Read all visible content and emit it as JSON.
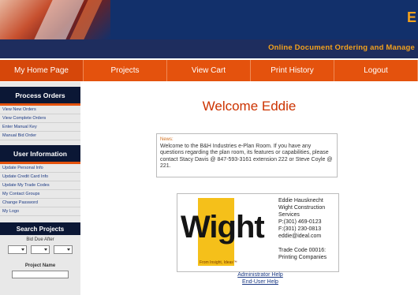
{
  "banner": {
    "letter": "E"
  },
  "subbar": {
    "text": "Online Document Ordering and Manage"
  },
  "nav": [
    "My Home Page",
    "Projects",
    "View Cart",
    "Print History",
    "Logout"
  ],
  "sidebar": {
    "process_orders": {
      "title": "Process Orders",
      "items": [
        "View New Orders",
        "View Complete Orders",
        "Enter Manual Key",
        "Manual Bid Order"
      ]
    },
    "user_information": {
      "title": "User Information",
      "items": [
        "Update Personal Info",
        "Update Credit Card Info",
        "Update My Trade Codes",
        "My Contact Groups",
        "Change Password",
        "My Logo"
      ]
    },
    "search": {
      "title": "Search Projects",
      "bid_due_label": "Bid Due After",
      "project_name_label": "Project Name"
    }
  },
  "main": {
    "welcome": "Welcome Eddie",
    "news_label": "News:",
    "news_text": "Welcome to the B&H Industries e-Plan Room. If you have any questions regarding the plan room, its features or capabilities, please contact Stacy Davis @ 847-593-3161 extension 222 or Steve Coyle @ 221."
  },
  "contact": {
    "logo_text": "Wight",
    "logo_tagline": "From Insight, Ideas™",
    "lines": [
      "Eddie Hausknecht",
      "Wight Construction",
      "Services",
      "P:(301) 469-0123",
      "F:(301) 230-0813",
      "eddie@ideal.com",
      "",
      "Trade Code 00016:",
      "Printing Companies"
    ]
  },
  "help": {
    "admin": "Administrator Help",
    "end_user": "End-User Help"
  }
}
